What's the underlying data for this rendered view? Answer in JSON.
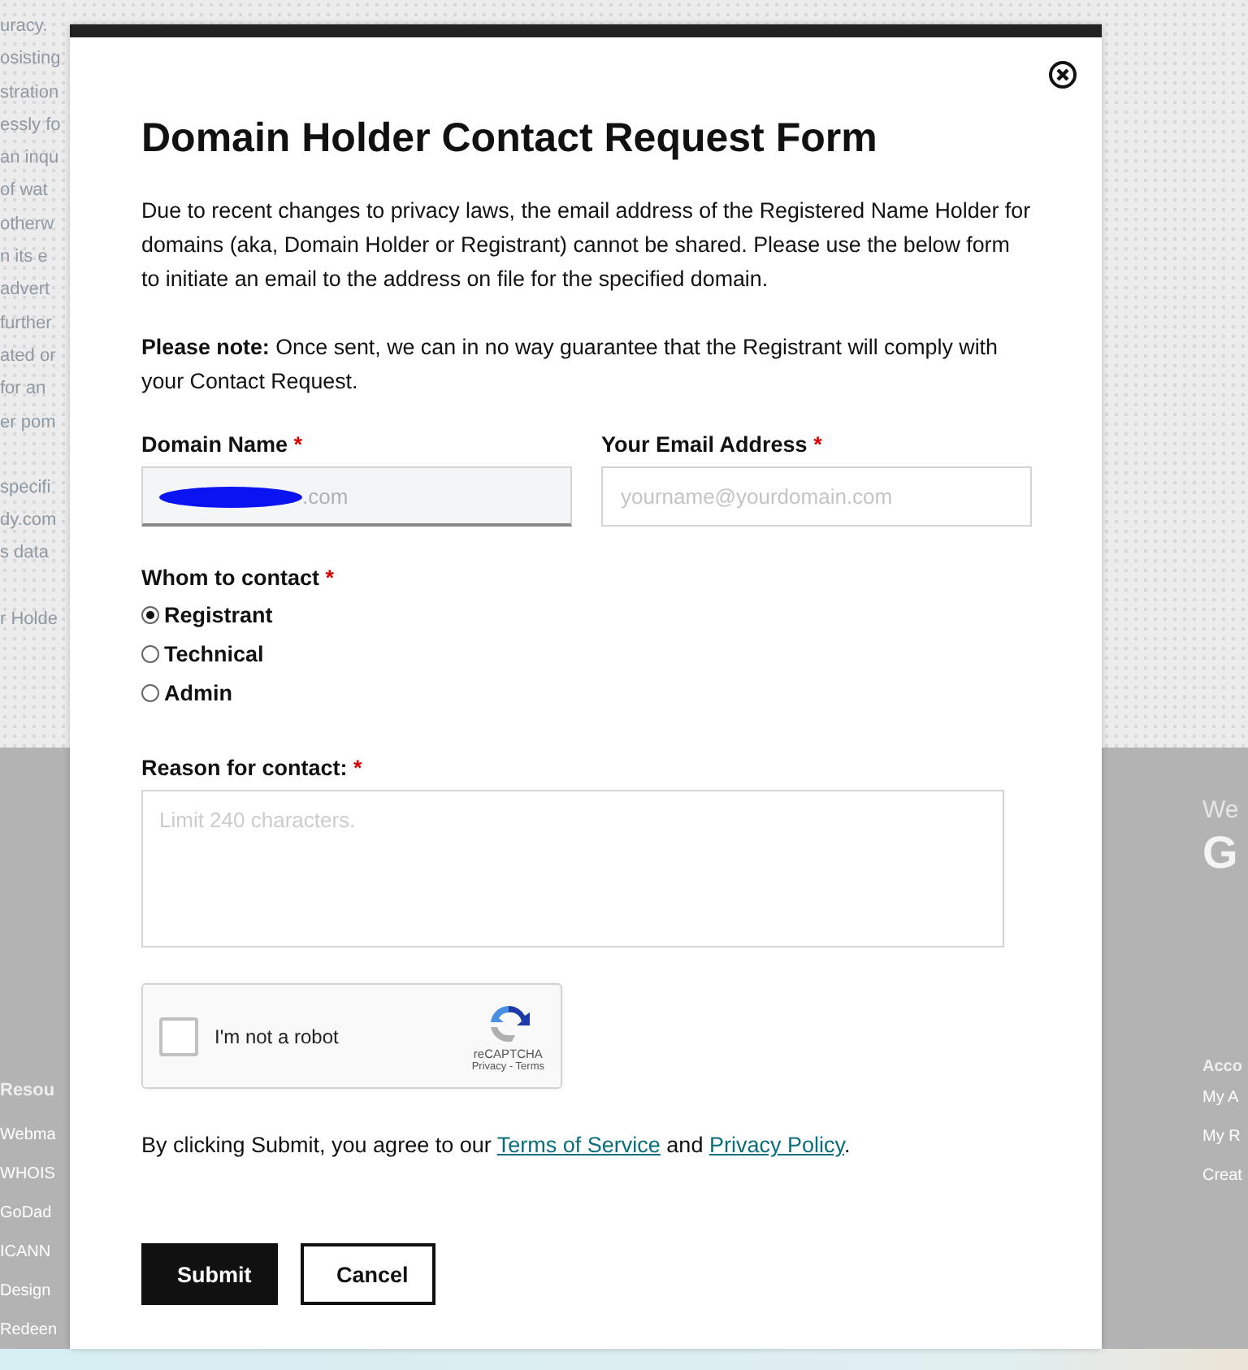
{
  "background": {
    "left_paragraphs": [
      [
        "uracy.",
        "osisting",
        "stration",
        "essly fo",
        "an inqu",
        "of wat",
        "otherw",
        "n its e",
        "advert",
        "further",
        "ated or",
        "for an",
        "er pom"
      ],
      [
        "specifi",
        "dy.com",
        "s data"
      ],
      [
        "r Holde"
      ]
    ],
    "footer_left": {
      "heading": "Resou",
      "links": [
        "Webma",
        "WHOIS",
        "GoDad",
        "ICANN",
        "Design",
        "Redeen"
      ]
    },
    "footer_right": {
      "tagline": "We",
      "logo_letter": "G",
      "heading": "Acco",
      "links": [
        "My A",
        "My R",
        "Creat"
      ]
    }
  },
  "dialog": {
    "title": "Domain Holder Contact Request Form",
    "intro": "Due to recent changes to privacy laws, the email address of the Registered Name Holder for domains (aka, Domain Holder or Registrant) cannot be shared. Please use the below form to initiate an email to the address on file for the specified domain.",
    "note": "**Please note:** Once sent, we can in no way guarantee that the Registrant will comply with your Contact Request.",
    "fields": [
      {
        "label": "Domain Name",
        "required_mark": "*",
        "value": ".com",
        "redacted": true,
        "disabled": true
      },
      {
        "label": "Your Email Address",
        "required_mark": "*",
        "placeholder": "yourname@yourdomain.com",
        "disabled": false
      }
    ],
    "contact": {
      "label": "Whom to contact",
      "required_mark": "*",
      "options": [
        {
          "label": "Registrant",
          "selected": true
        },
        {
          "label": "Technical",
          "selected": false
        },
        {
          "label": "Admin",
          "selected": false
        }
      ]
    },
    "reason": {
      "label": "Reason for contact:",
      "required_mark": "*",
      "placeholder": "Limit 240 characters."
    },
    "captcha": {
      "label": "I'm not a robot",
      "checked": false,
      "brand": "reCAPTCHA",
      "links": "Privacy - Terms"
    },
    "consent": {
      "before": "By clicking Submit, you agree to our",
      "link1": "Terms of Service",
      "middle": "and",
      "link2": "Privacy Policy",
      "after": "."
    },
    "buttons": [
      {
        "label": "Submit",
        "kind": "primary"
      },
      {
        "label": "Cancel",
        "kind": "secondary"
      }
    ]
  }
}
